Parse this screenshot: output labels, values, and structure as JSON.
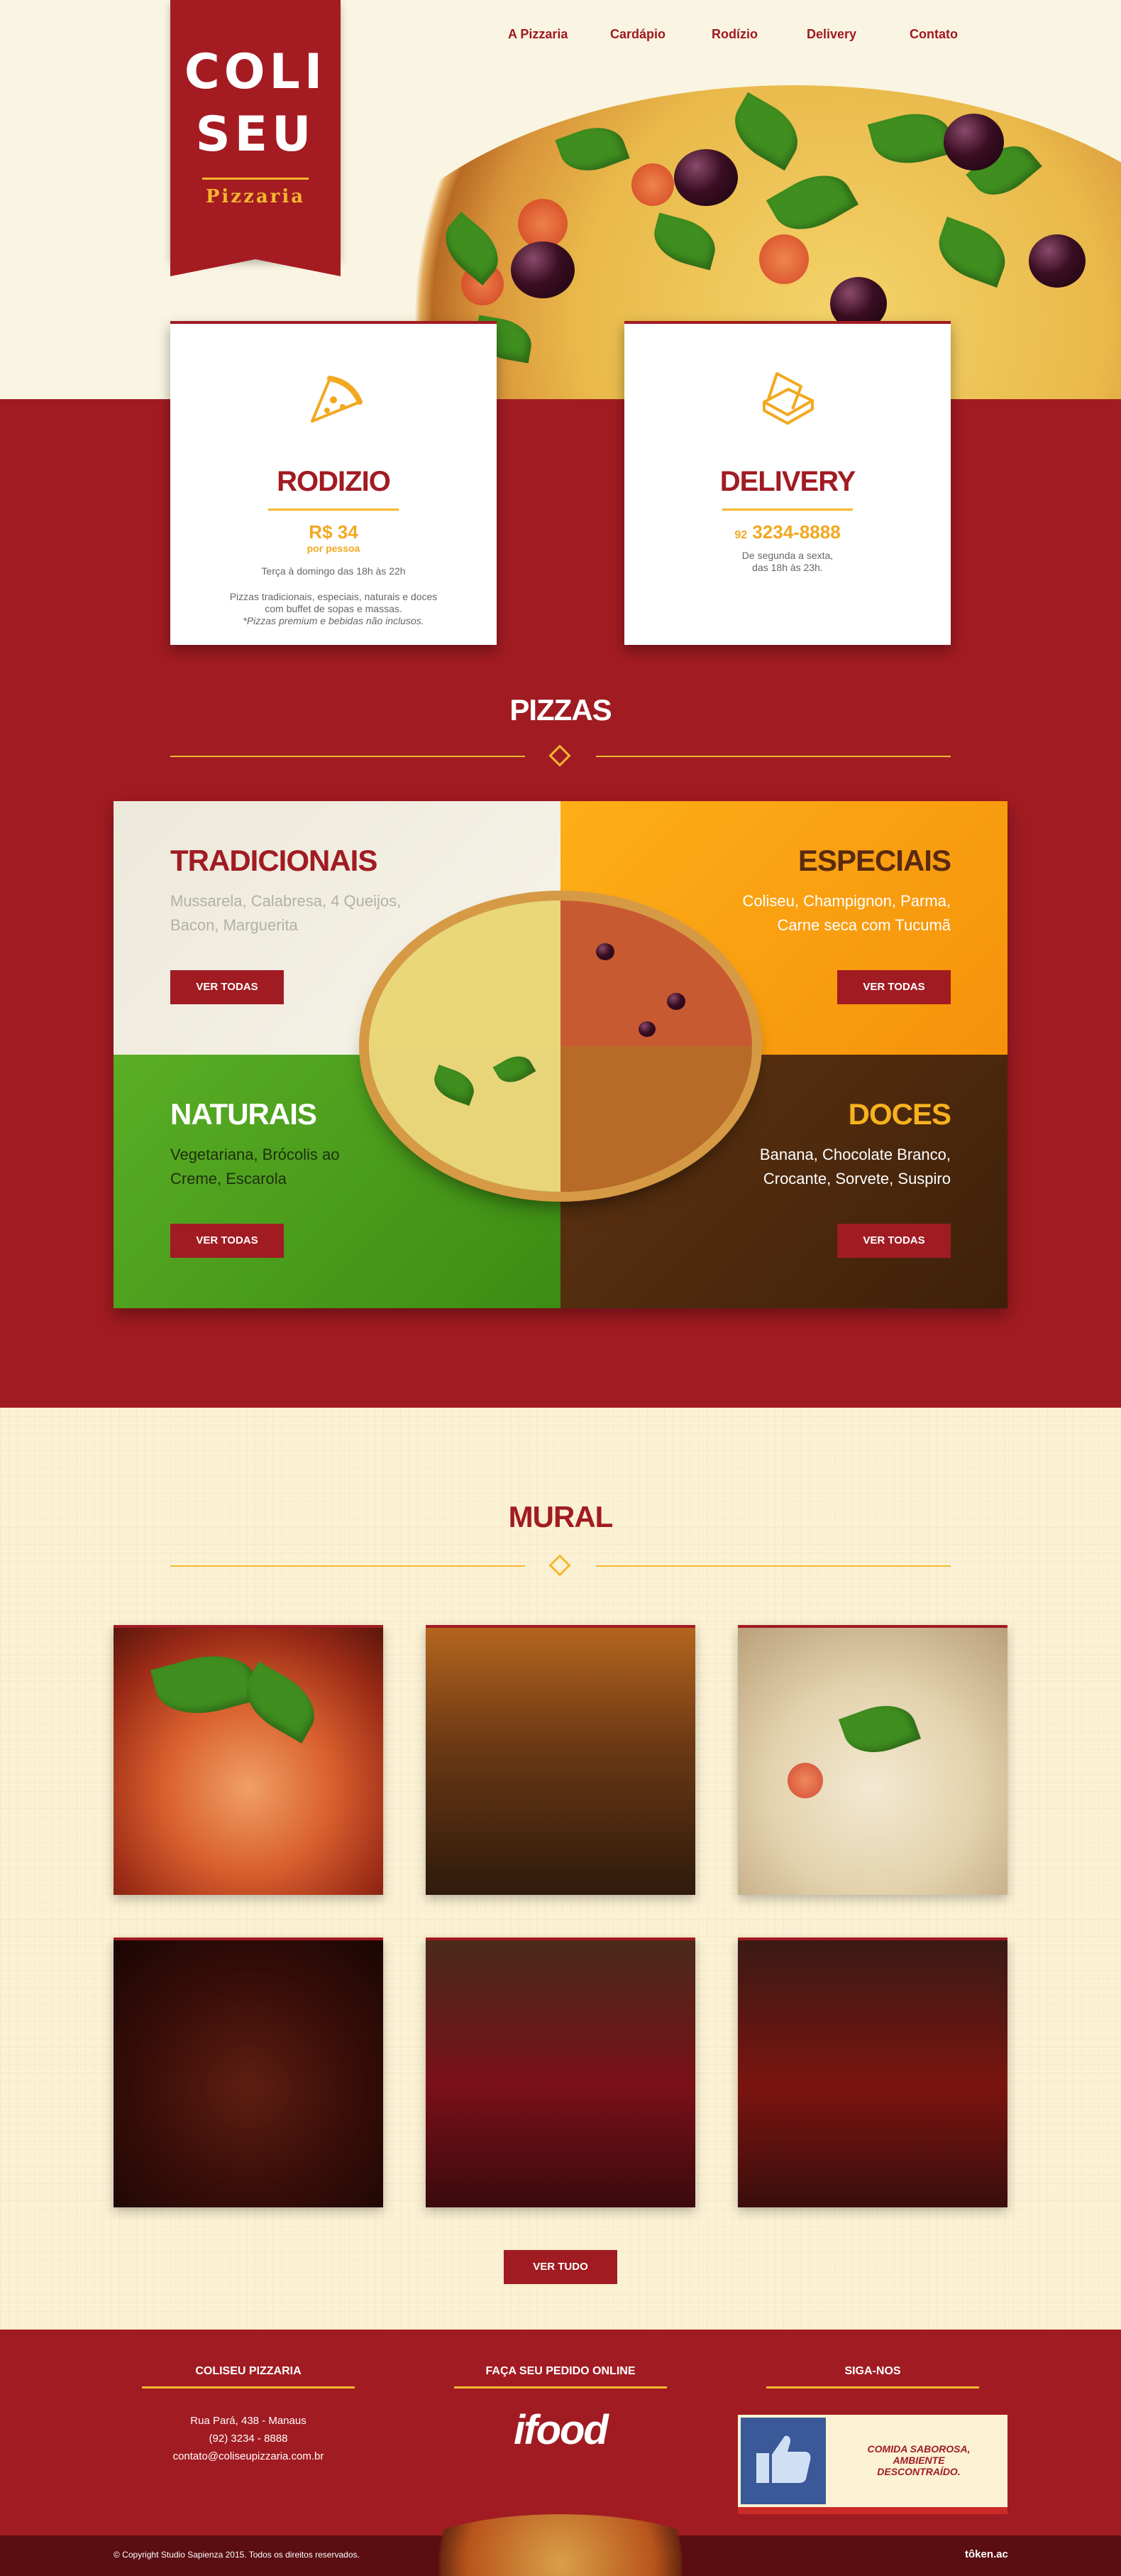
{
  "nav": {
    "items": [
      "A Pizzaria",
      "Cardápio",
      "Rodízio",
      "Delivery",
      "Contato"
    ]
  },
  "logo": {
    "line1": "COLI",
    "line2": "SEU",
    "sub": "Pizzaria"
  },
  "cards": {
    "rodizio": {
      "title": "RODIZIO",
      "price": "R$ 34",
      "per": "por pessoa",
      "hours": "Terça à domingo das 18h às 22h",
      "desc1": "Pizzas tradicionais, especiais, naturais e doces",
      "desc2": "com buffet de sopas e massas.",
      "desc3": "*Pizzas premium e bebidas não inclusos."
    },
    "delivery": {
      "title": "DELIVERY",
      "area_code": "92",
      "phone": "3234-8888",
      "hours1": "De segunda a sexta,",
      "hours2": "das 18h às 23h."
    }
  },
  "pizzas": {
    "title": "PIZZAS",
    "tradicionais": {
      "title": "TRADICIONAIS",
      "desc1": "Mussarela, Calabresa, 4 Queijos,",
      "desc2": "Bacon, Marguerita",
      "button": "VER TODAS"
    },
    "especiais": {
      "title": "ESPECIAIS",
      "desc1": "Coliseu, Champignon, Parma,",
      "desc2": "Carne seca com Tucumã",
      "button": "VER TODAS"
    },
    "naturais": {
      "title": "NATURAIS",
      "desc1": "Vegetariana, Brócolis ao",
      "desc2": "Creme, Escarola",
      "button": "VER TODAS"
    },
    "doces": {
      "title": "DOCES",
      "desc1": "Banana, Chocolate Branco,",
      "desc2": "Crocante, Sorvete, Suspiro",
      "button": "VER TODAS"
    }
  },
  "mural": {
    "title": "MURAL",
    "photos": [
      "shrimp-dish",
      "friends-dinner",
      "pasta-dish",
      "feijoada",
      "red-wine",
      "couple-flowers"
    ],
    "button": "VER TUDO"
  },
  "footer": {
    "col1_title": "COLISEU PIZZARIA",
    "address": "Rua Pará, 438 - Manaus",
    "phone": "(92) 3234 - 8888",
    "email": "contato@coliseupizzaria.com.br",
    "col2_title": "FAÇA SEU PEDIDO ONLINE",
    "ifood": "ifood",
    "col3_title": "SIGA-NOS",
    "fb_text1": "COMIDA SABOROSA,",
    "fb_text2": "AMBIENTE DESCONTRAÍDO.",
    "copyright": "© Copyright Studio Sapienza 2015. Todos os direitos reservados.",
    "credit": "tôken.ac"
  },
  "colors": {
    "brand_red": "#a11b22",
    "accent_yellow": "#f5b82e",
    "cream": "#faf5e2"
  }
}
